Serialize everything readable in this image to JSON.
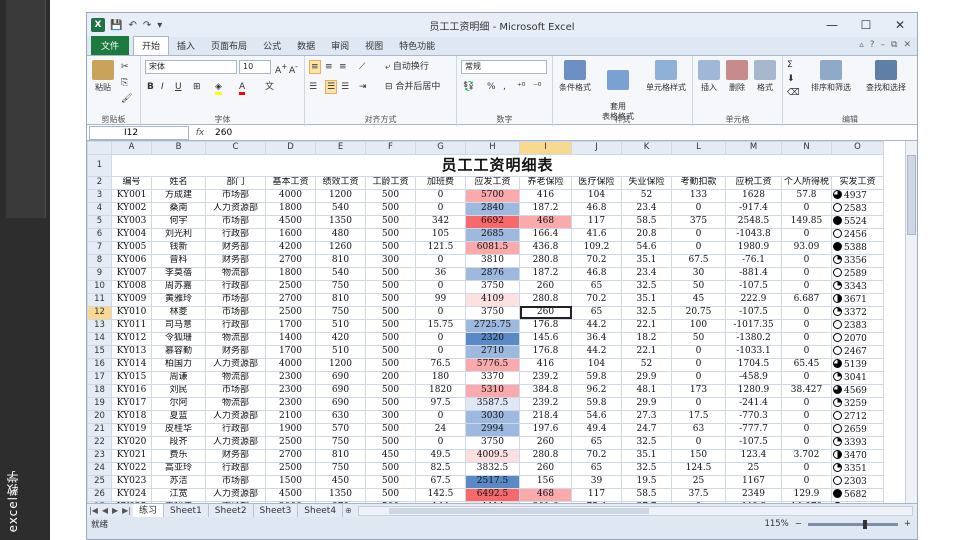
{
  "side_strip": {
    "vertical_text": "excel教学"
  },
  "window": {
    "title": "员工工资明细 - Microsoft Excel",
    "qat_logo": "X",
    "qat": [
      "💾",
      "↶",
      "↷",
      "▾"
    ],
    "controls": [
      "—",
      "☐",
      "✕"
    ]
  },
  "tabs": [
    {
      "label": "文件",
      "kind": "file"
    },
    {
      "label": "开始",
      "kind": "active"
    },
    {
      "label": "插入",
      "kind": ""
    },
    {
      "label": "页面布局",
      "kind": ""
    },
    {
      "label": "公式",
      "kind": ""
    },
    {
      "label": "数据",
      "kind": ""
    },
    {
      "label": "审阅",
      "kind": ""
    },
    {
      "label": "视图",
      "kind": ""
    },
    {
      "label": "特色功能",
      "kind": ""
    }
  ],
  "tabs_right": [
    "▵",
    "?",
    "–",
    "⧉",
    "✕"
  ],
  "ribbon": {
    "groups": {
      "clipboard": "剪贴板",
      "font": "字体",
      "align": "对齐方式",
      "number": "数字",
      "style": "样式",
      "cells": "单元格",
      "edit": "编辑"
    },
    "paste": "粘贴",
    "font_name": "宋体",
    "font_size": "10",
    "wrap": "自动换行",
    "merge": "合并后居中",
    "number_format": "常规",
    "percent": "%",
    "comma": ",",
    "cond_format": "条件格式",
    "apply_table": "套用\n表格格式",
    "cell_style": "单元格样式",
    "insert": "插入",
    "delete": "删除",
    "format": "格式",
    "sort_filter": "排序和筛选",
    "find_select": "查找和选择",
    "sigma": "Σ"
  },
  "formula_bar": {
    "name_box": "I12",
    "fx": "fx",
    "value": "260"
  },
  "sheet": {
    "title": "员工工资明细表",
    "col_letters": [
      "A",
      "B",
      "C",
      "D",
      "E",
      "F",
      "G",
      "H",
      "I",
      "J",
      "K",
      "L",
      "M",
      "N",
      "O"
    ],
    "selected_col": "I",
    "selected_row": 12,
    "headers": [
      "编号",
      "姓名",
      "部门",
      "基本工资",
      "绩效工资",
      "工龄工资",
      "加班费",
      "应发工资",
      "养老保险",
      "医疗保险",
      "失业保险",
      "考勤扣款",
      "应税工资",
      "个人所得税",
      "实发工资"
    ],
    "rows": [
      {
        "n": 3,
        "cells": [
          "KY001",
          "方成建",
          "市场部",
          "4000",
          "1200",
          "500",
          "0",
          "5700",
          "416",
          "104",
          "52",
          "133",
          "1628",
          "57.8",
          "4937"
        ],
        "h": "c-red",
        "i": "c-white",
        "pie": "q3"
      },
      {
        "n": 4,
        "cells": [
          "KY002",
          "桑南",
          "人力资源部",
          "1800",
          "540",
          "500",
          "0",
          "2840",
          "187.2",
          "46.8",
          "23.4",
          "0",
          "-917.4",
          "0",
          "2583"
        ],
        "h": "c-blue",
        "i": "c-white",
        "pie": "q0"
      },
      {
        "n": 5,
        "cells": [
          "KY003",
          "何宇",
          "市场部",
          "4500",
          "1350",
          "500",
          "342",
          "6692",
          "468",
          "117",
          "58.5",
          "375",
          "2548.5",
          "149.85",
          "5524"
        ],
        "h": "c-red-strong",
        "i": "c-red",
        "pie": "q4"
      },
      {
        "n": 6,
        "cells": [
          "KY004",
          "刘光利",
          "行政部",
          "1600",
          "480",
          "500",
          "105",
          "2685",
          "166.4",
          "41.6",
          "20.8",
          "0",
          "-1043.8",
          "0",
          "2456"
        ],
        "h": "c-blue",
        "i": "c-white",
        "pie": "q0"
      },
      {
        "n": 7,
        "cells": [
          "KY005",
          "钱新",
          "财务部",
          "4200",
          "1260",
          "500",
          "121.5",
          "6081.5",
          "436.8",
          "109.2",
          "54.6",
          "0",
          "1980.9",
          "93.09",
          "5388"
        ],
        "h": "c-red",
        "i": "c-white",
        "pie": "q4"
      },
      {
        "n": 8,
        "cells": [
          "KY006",
          "曾科",
          "财务部",
          "2700",
          "810",
          "300",
          "0",
          "3810",
          "280.8",
          "70.2",
          "35.1",
          "67.5",
          "-76.1",
          "0",
          "3356"
        ],
        "h": "c-white",
        "i": "c-white",
        "pie": "q1"
      },
      {
        "n": 9,
        "cells": [
          "KY007",
          "李莫蓓",
          "物流部",
          "1800",
          "540",
          "500",
          "36",
          "2876",
          "187.2",
          "46.8",
          "23.4",
          "30",
          "-881.4",
          "0",
          "2589"
        ],
        "h": "c-blue",
        "i": "c-white",
        "pie": "q0"
      },
      {
        "n": 10,
        "cells": [
          "KY008",
          "周苏嘉",
          "行政部",
          "2500",
          "750",
          "500",
          "0",
          "3750",
          "260",
          "65",
          "32.5",
          "50",
          "-107.5",
          "0",
          "3343"
        ],
        "h": "c-white",
        "i": "c-white",
        "pie": "q1"
      },
      {
        "n": 11,
        "cells": [
          "KY009",
          "黄雅玲",
          "市场部",
          "2700",
          "810",
          "500",
          "99",
          "4109",
          "280.8",
          "70.2",
          "35.1",
          "45",
          "222.9",
          "6.687",
          "3671"
        ],
        "h": "c-red-light",
        "i": "c-white",
        "pie": "q2"
      },
      {
        "n": 12,
        "cells": [
          "KY010",
          "林菱",
          "市场部",
          "2500",
          "750",
          "500",
          "0",
          "3750",
          "260",
          "65",
          "32.5",
          "20.75",
          "-107.5",
          "0",
          "3372"
        ],
        "h": "c-white",
        "i": "c-white",
        "pie": "q1"
      },
      {
        "n": 13,
        "cells": [
          "KY011",
          "司马意",
          "行政部",
          "1700",
          "510",
          "500",
          "15.75",
          "2725.75",
          "176.8",
          "44.2",
          "22.1",
          "100",
          "-1017.35",
          "0",
          "2383"
        ],
        "h": "c-blue",
        "i": "c-white",
        "pie": "q0"
      },
      {
        "n": 14,
        "cells": [
          "KY012",
          "令狐珊",
          "物流部",
          "1400",
          "420",
          "500",
          "0",
          "2320",
          "145.6",
          "36.4",
          "18.2",
          "50",
          "-1380.2",
          "0",
          "2070"
        ],
        "h": "c-blue-strong",
        "i": "c-white",
        "pie": "q0"
      },
      {
        "n": 15,
        "cells": [
          "KY013",
          "慕容勤",
          "财务部",
          "1700",
          "510",
          "500",
          "0",
          "2710",
          "176.8",
          "44.2",
          "22.1",
          "0",
          "-1033.1",
          "0",
          "2467"
        ],
        "h": "c-blue",
        "i": "c-white",
        "pie": "q0"
      },
      {
        "n": 16,
        "cells": [
          "KY014",
          "柏国力",
          "人力资源部",
          "4000",
          "1200",
          "500",
          "76.5",
          "5776.5",
          "416",
          "104",
          "52",
          "0",
          "1704.5",
          "65.45",
          "5139"
        ],
        "h": "c-red",
        "i": "c-white",
        "pie": "q3"
      },
      {
        "n": 17,
        "cells": [
          "KY015",
          "周谦",
          "物流部",
          "2300",
          "690",
          "200",
          "180",
          "3370",
          "239.2",
          "59.8",
          "29.9",
          "0",
          "-458.9",
          "0",
          "3041"
        ],
        "h": "c-white",
        "i": "c-white",
        "pie": "q1"
      },
      {
        "n": 18,
        "cells": [
          "KY016",
          "刘民",
          "市场部",
          "2300",
          "690",
          "500",
          "1820",
          "5310",
          "384.8",
          "96.2",
          "48.1",
          "173",
          "1280.9",
          "38.427",
          "4569"
        ],
        "h": "c-red",
        "i": "c-white",
        "pie": "q3"
      },
      {
        "n": 19,
        "cells": [
          "KY017",
          "尔阿",
          "物流部",
          "2300",
          "690",
          "500",
          "97.5",
          "3587.5",
          "239.2",
          "59.8",
          "29.9",
          "0",
          "-241.4",
          "0",
          "3259"
        ],
        "h": "c-blue-light",
        "i": "c-white",
        "pie": "q1"
      },
      {
        "n": 20,
        "cells": [
          "KY018",
          "夏蓝",
          "人力资源部",
          "2100",
          "630",
          "300",
          "0",
          "3030",
          "218.4",
          "54.6",
          "27.3",
          "17.5",
          "-770.3",
          "0",
          "2712"
        ],
        "h": "c-blue",
        "i": "c-white",
        "pie": "q0"
      },
      {
        "n": 21,
        "cells": [
          "KY019",
          "皮桂华",
          "行政部",
          "1900",
          "570",
          "500",
          "24",
          "2994",
          "197.6",
          "49.4",
          "24.7",
          "63",
          "-777.7",
          "0",
          "2659"
        ],
        "h": "c-blue",
        "i": "c-white",
        "pie": "q0"
      },
      {
        "n": 22,
        "cells": [
          "KY020",
          "段齐",
          "人力资源部",
          "2500",
          "750",
          "500",
          "0",
          "3750",
          "260",
          "65",
          "32.5",
          "0",
          "-107.5",
          "0",
          "3393"
        ],
        "h": "c-white",
        "i": "c-white",
        "pie": "q1"
      },
      {
        "n": 23,
        "cells": [
          "KY021",
          "费乐",
          "财务部",
          "2700",
          "810",
          "450",
          "49.5",
          "4009.5",
          "280.8",
          "70.2",
          "35.1",
          "150",
          "123.4",
          "3.702",
          "3470"
        ],
        "h": "c-red-light",
        "i": "c-white",
        "pie": "q2"
      },
      {
        "n": 24,
        "cells": [
          "KY022",
          "高亚玲",
          "行政部",
          "2500",
          "750",
          "500",
          "82.5",
          "3832.5",
          "260",
          "65",
          "32.5",
          "124.5",
          "25",
          "0",
          "3351"
        ],
        "h": "c-white",
        "i": "c-white",
        "pie": "q1"
      },
      {
        "n": 25,
        "cells": [
          "KY023",
          "苏洁",
          "市场部",
          "1500",
          "450",
          "500",
          "67.5",
          "2517.5",
          "156",
          "39",
          "19.5",
          "25",
          "1167",
          "0",
          "2303"
        ],
        "h": "c-blue-strong",
        "i": "c-white",
        "pie": "q0"
      },
      {
        "n": 26,
        "cells": [
          "KY024",
          "江宽",
          "人力资源部",
          "4500",
          "1350",
          "500",
          "142.5",
          "6492.5",
          "468",
          "117",
          "58.5",
          "37.5",
          "2349",
          "129.9",
          "5682"
        ],
        "h": "c-red-strong",
        "i": "c-red",
        "pie": "q4"
      },
      {
        "n": 27,
        "cells": [
          "KY025",
          "王利伟",
          "市场部",
          "2900",
          "870",
          "500",
          "144",
          "4414",
          "301.6",
          "75.4",
          "37.7",
          "0",
          "440.3",
          "14.079",
          "3984"
        ],
        "h": "c-red-light",
        "i": "c-white",
        "pie": "q2"
      }
    ]
  },
  "sheet_tabs": [
    "练习",
    "Sheet1",
    "Sheet2",
    "Sheet3",
    "Sheet4"
  ],
  "sheet_nav": [
    "|◀",
    "◀",
    "▶",
    "▶|"
  ],
  "new_sheet": "⊕",
  "status": {
    "ready": "就绪",
    "zoom": "115%",
    "zoom_minus": "−",
    "zoom_plus": "+"
  }
}
